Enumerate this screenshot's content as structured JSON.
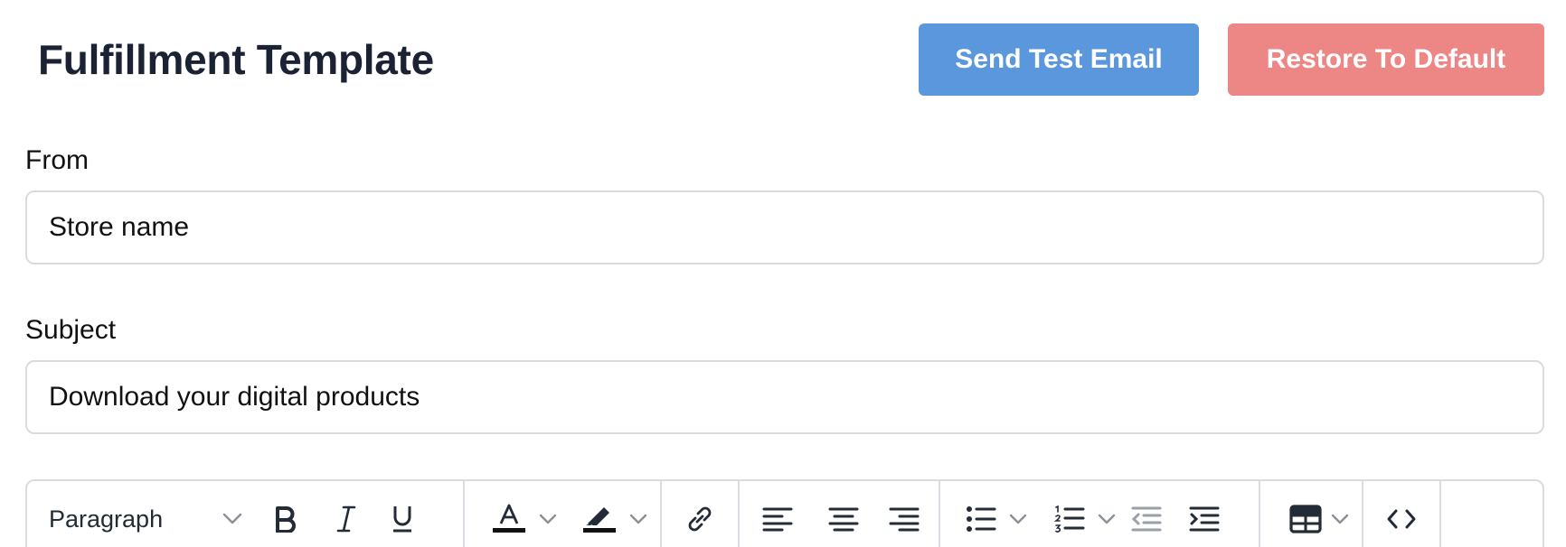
{
  "header": {
    "title": "Fulfillment Template",
    "send_test_label": "Send Test Email",
    "restore_label": "Restore To Default"
  },
  "form": {
    "from": {
      "label": "From",
      "value": "Store name"
    },
    "subject": {
      "label": "Subject",
      "value": "Download your digital products"
    }
  },
  "editor": {
    "toolbar": {
      "block_format": "Paragraph",
      "icons": [
        "bold-icon",
        "italic-icon",
        "underline-icon",
        "text-color-icon",
        "highlight-icon",
        "link-icon",
        "align-left-icon",
        "align-center-icon",
        "align-right-icon",
        "bullet-list-icon",
        "numbered-list-icon",
        "outdent-icon",
        "indent-icon",
        "table-icon",
        "source-code-icon"
      ]
    }
  },
  "colors": {
    "send_test_button": "#5b97dd",
    "restore_button": "#ec8785",
    "title_text": "#1a2233",
    "border": "#d9dbe0"
  }
}
